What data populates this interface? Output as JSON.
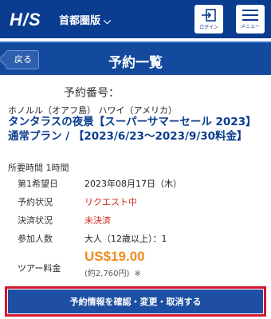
{
  "header": {
    "logo": "H/S",
    "region": "首都圏版",
    "region_chevron": "⌵",
    "login_label": "ログイン",
    "menu_label": "メニュー"
  },
  "subheader": {
    "back_label": "戻る",
    "title": "予約一覧"
  },
  "reservation": {
    "number_label": "予約番号：",
    "location": "ホノルル（オアフ島） ハワイ（アメリカ）",
    "tour_title": "タンタラスの夜景【スーパーサマーセール 2023】 通常プラン / 【2023/6/23～2023/9/30料金】",
    "duration": "所要時間 1時間",
    "rows": [
      {
        "key": "第1希望日",
        "value": "2023年08月17日（木）",
        "status": "normal"
      },
      {
        "key": "予約状況",
        "value": "リクエスト中",
        "status": "alert"
      },
      {
        "key": "決済状況",
        "value": "未決済",
        "status": "alert"
      },
      {
        "key": "参加人数",
        "value": "大人（12歳以上）：1",
        "status": "normal"
      }
    ],
    "price_label": "ツアー料金",
    "price": "US$19.00",
    "price_local": "(約2,760円)",
    "price_note": "※"
  },
  "cta": {
    "label": "予約情報を確認・変更・取消する"
  },
  "colors": {
    "brand": "#0a3c8f",
    "alert": "#d0281f",
    "price": "#f08c1e",
    "cta_border": "#d8162e"
  }
}
